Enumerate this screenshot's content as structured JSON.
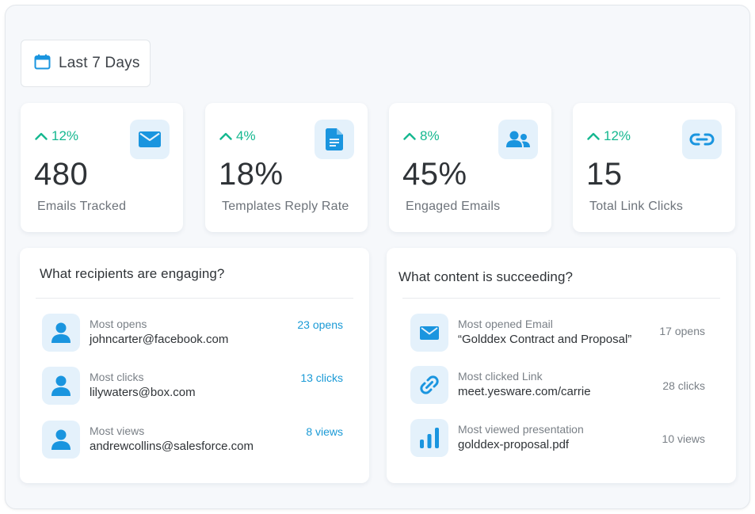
{
  "date_filter": {
    "label": "Last 7 Days",
    "icon": "calendar-icon"
  },
  "colors": {
    "accent": "#1a9ad6",
    "trend_up": "#16b890",
    "icon_bg": "#e4f1fb",
    "icon": "#1a95df"
  },
  "stats": [
    {
      "trend": "12%",
      "value": "480",
      "label": "Emails Tracked",
      "icon": "envelope-icon"
    },
    {
      "trend": "4%",
      "value": "18%",
      "label": "Templates Reply Rate",
      "icon": "document-icon"
    },
    {
      "trend": "8%",
      "value": "45%",
      "label": "Engaged Emails",
      "icon": "users-icon"
    },
    {
      "trend": "12%",
      "value": "15",
      "label": "Total Link Clicks",
      "icon": "link-icon"
    }
  ],
  "recipients": {
    "title": "What recipients are engaging?",
    "rows": [
      {
        "label": "Most opens",
        "value": "johncarter@facebook.com",
        "metric": "23 opens",
        "icon": "user-icon"
      },
      {
        "label": "Most clicks",
        "value": "lilywaters@box.com",
        "metric": "13 clicks",
        "icon": "user-icon"
      },
      {
        "label": "Most views",
        "value": "andrewcollins@salesforce.com",
        "metric": "8 views",
        "icon": "user-icon"
      }
    ]
  },
  "content": {
    "title": "What content is succeeding?",
    "rows": [
      {
        "label": "Most opened Email",
        "value": "“Golddex Contract and Proposal”",
        "metric": "17  opens",
        "icon": "envelope-icon"
      },
      {
        "label": "Most clicked Link",
        "value": "meet.yesware.com/carrie",
        "metric": "28  clicks",
        "icon": "chain-link-icon"
      },
      {
        "label": "Most viewed presentation",
        "value": "golddex-proposal.pdf",
        "metric": "10  views",
        "icon": "bar-chart-icon"
      }
    ]
  }
}
